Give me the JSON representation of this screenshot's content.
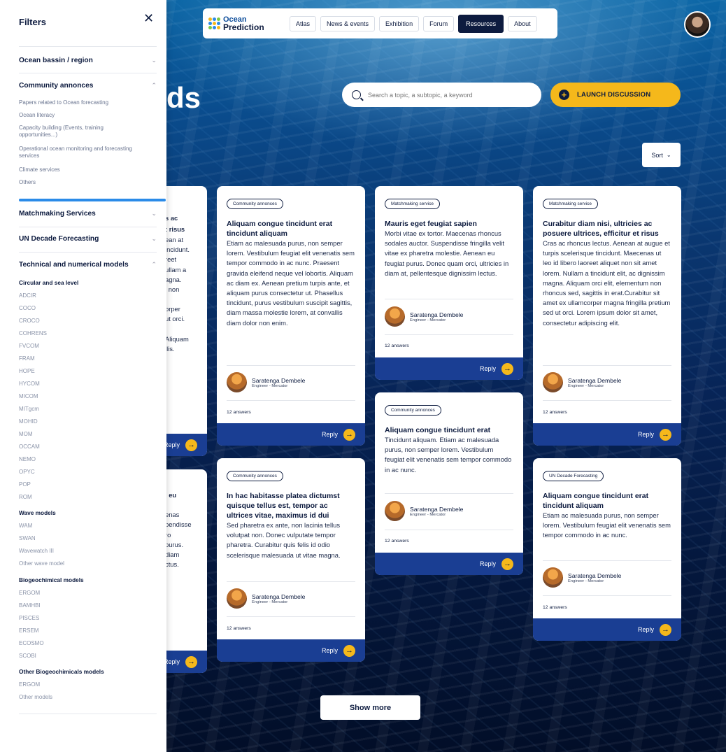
{
  "nav": {
    "logo_line1": "Ocean",
    "logo_line2": "Prediction",
    "items": [
      "Atlas",
      "News & events",
      "Exhibition",
      "Forum",
      "Resources",
      "About"
    ],
    "active": "Resources"
  },
  "page": {
    "title_fragment": "ds"
  },
  "search": {
    "placeholder": "Search a topic, a subtopic, a keyword"
  },
  "launch_label": "LAUNCH DISCUSSION",
  "sort_label": "Sort",
  "show_more_label": "Show more",
  "cards": [
    {
      "tag": "Community annonces",
      "title": "Aliquam congue tincidunt erat tincidunt aliquam",
      "text": "Etiam ac malesuada purus, non semper lorem. Vestibulum feugiat elit venenatis sem tempor commodo in ac nunc. Praesent gravida eleifend neque vel lobortis. Aliquam ac diam ex. Aenean pretium turpis ante, et aliquam purus consectetur ut. Phasellus tincidunt, purus vestibulum suscipit sagittis, diam massa molestie lorem, at convallis diam dolor non enim.",
      "author": "Saratenga Dembele",
      "role": "Engineer - Mercator",
      "answers": "12 answers",
      "reply": "Reply"
    },
    {
      "tag": "Matchmaking service",
      "title": "Mauris eget feugiat sapien",
      "text": "Morbi vitae ex tortor. Maecenas rhoncus sodales auctor. Suspendisse fringilla velit vitae ex pharetra molestie. Aenean eu feugiat purus. Donec quam orci, ultricies in diam at, pellentesque dignissim lectus.",
      "author": "Saratenga Dembele",
      "role": "Engineer - Mercator",
      "answers": "12 answers",
      "reply": "Reply"
    },
    {
      "tag": "Matchmaking service",
      "title": "Curabitur diam nisi, ultricies ac posuere ultrices, efficitur et risus",
      "text": "Cras ac rhoncus lectus. Aenean at augue et turpis scelerisque tincidunt. Maecenas ut leo id libero laoreet aliquet non sit amet lorem. Nullam a tincidunt elit, ac dignissim magna. Aliquam orci elit, elementum non rhoncus sed, sagittis in erat.Curabitur sit amet ex ullamcorper magna fringilla pretium sed ut orci. Lorem ipsum dolor sit amet, consectetur adipiscing elit.",
      "author": "Saratenga Dembele",
      "role": "Engineer - Mercator",
      "answers": "12 answers",
      "reply": "Reply"
    },
    {
      "tag": "Community annonces",
      "title": "Aliquam congue tincidunt erat",
      "text": "Tincidunt aliquam. Etiam ac malesuada purus, non semper lorem. Vestibulum feugiat elit venenatis sem tempor commodo in ac nunc.",
      "author": "Saratenga Dembele",
      "role": "Engineer - Mercator",
      "answers": "12 answers",
      "reply": "Reply"
    },
    {
      "tag": "Community annonces",
      "title": "In hac habitasse platea dictumst quisque tellus est, tempor ac ultrices vitae, maximus id dui",
      "text": "Sed pharetra ex ante, non lacinia tellus volutpat non. Donec vulputate tempor pharetra. Curabitur quis felis id odio scelerisque malesuada ut vitae magna.",
      "author": "Saratenga Dembele",
      "role": "Engineer - Mercator",
      "answers": "12 answers",
      "reply": "Reply"
    },
    {
      "tag": "UN Decade Forecasting",
      "title": "Aliquam congue tincidunt erat tincidunt aliquam",
      "text": "Etiam ac malesuada purus, non semper lorem. Vestibulum feugiat elit venenatis sem tempor commodo in ac nunc.",
      "author": "Saratenga Dembele",
      "role": "Engineer - Mercator",
      "answers": "12 answers",
      "reply": "Reply"
    }
  ],
  "partial_cards": [
    {
      "lines": [
        "s ac",
        "t risus",
        "ean at",
        "incidunt.",
        "reet",
        "ullam a",
        "agna.",
        "i non",
        "",
        "",
        "orper",
        "ut orci.",
        "",
        "Aliquam",
        "llis."
      ],
      "reply": "Reply"
    },
    {
      "lines": [
        "",
        ", eu",
        "",
        "enas",
        "pendisse",
        "ro",
        "purus.",
        "diam",
        "ctus."
      ],
      "reply": "Reply"
    }
  ],
  "filters": {
    "title": "Filters",
    "sections": [
      {
        "label": "Ocean bassin / region",
        "expanded": false
      },
      {
        "label": "Community annonces",
        "expanded": true
      },
      {
        "label": "Matchmaking Services",
        "expanded": false
      },
      {
        "label": "UN Decade Forecasting",
        "expanded": false
      },
      {
        "label": "Technical and numerical models",
        "expanded": true
      }
    ],
    "community_items": [
      "Papers related to Ocean forecasting",
      "Ocean literacy",
      "Capacity building (Events, training opportunities...)",
      "Operational ocean monitoring and forecasting services",
      "Climate services",
      "Others"
    ],
    "model_groups": [
      {
        "label": "Circular and sea level",
        "items": [
          "ADCIR",
          "COCO",
          "CROCO",
          "COHRENS",
          "FVCOM",
          "FRAM",
          "HOPE",
          "HYCOM",
          "MICOM",
          "MITgcm",
          "MOHID",
          "MOM",
          "OCCAM",
          "NEMO",
          "OPYC",
          "POP",
          "ROM"
        ]
      },
      {
        "label": "Wave models",
        "items": [
          "WAM",
          "SWAN",
          "Wavewatch III",
          "Other wave model"
        ]
      },
      {
        "label": "Biogeochimical models",
        "items": [
          "ERGOM",
          "BAMHBI",
          "PISCES",
          "ERSEM",
          "ECOSMO",
          "SCOBI"
        ]
      },
      {
        "label": "Other Biogeochimicals models",
        "items": [
          "ERGOM",
          "Other models"
        ]
      }
    ]
  },
  "colors": {
    "accent": "#f5b81b",
    "reply_bar": "#1a3e93",
    "navy": "#0d1b3f",
    "filter_bar": "#2b8be8"
  }
}
